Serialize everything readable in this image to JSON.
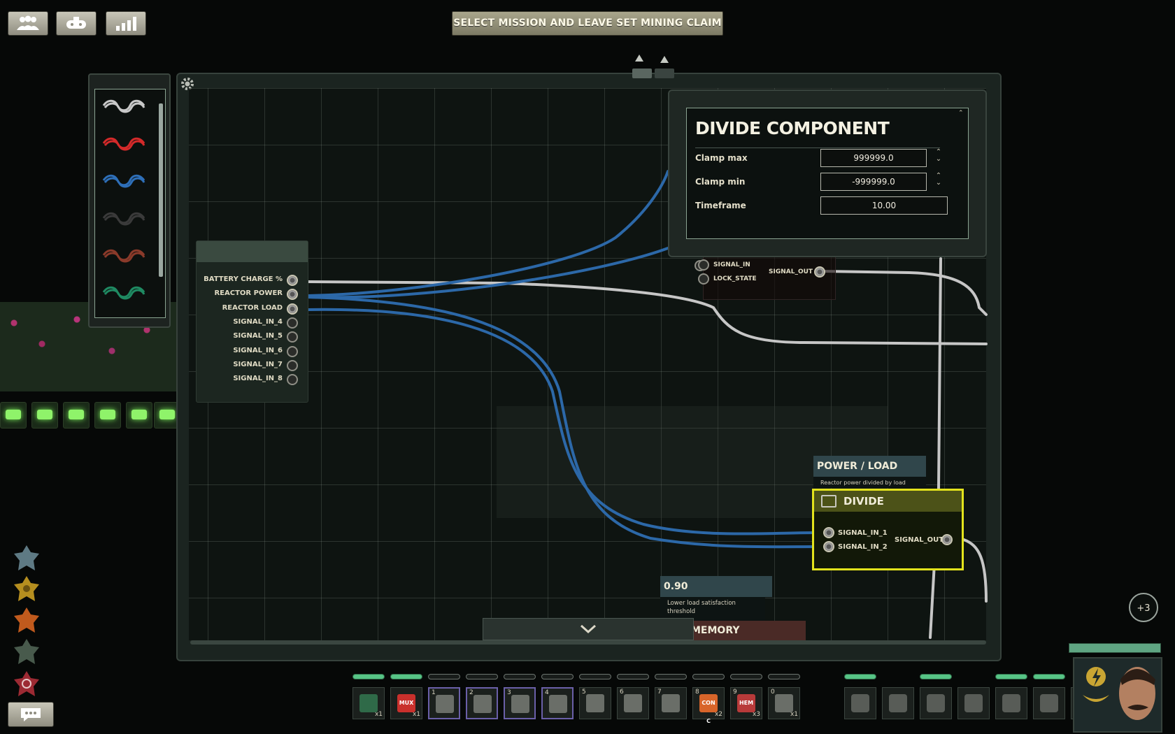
{
  "banner": {
    "text": "SELECT MISSION AND LEAVE SET MINING CLAIM"
  },
  "top_buttons": [
    {
      "icon": "crew-icon"
    },
    {
      "icon": "submarine-icon"
    },
    {
      "icon": "stats-bars-icon"
    }
  ],
  "palette": {
    "wires": [
      "#c8c8c8",
      "#d42a2a",
      "#2e6fb8",
      "#2b2b2b",
      "#8a3a2a",
      "#1f8a62"
    ]
  },
  "input_component": {
    "connectors": [
      {
        "label": "BATTERY CHARGE %",
        "connected": true
      },
      {
        "label": "REACTOR POWER",
        "connected": true
      },
      {
        "label": "REACTOR LOAD",
        "connected": true
      },
      {
        "label": "SIGNAL_IN_4",
        "connected": false
      },
      {
        "label": "SIGNAL_IN_5",
        "connected": false
      },
      {
        "label": "SIGNAL_IN_6",
        "connected": false
      },
      {
        "label": "SIGNAL_IN_7",
        "connected": false
      },
      {
        "label": "SIGNAL_IN_8",
        "connected": false
      }
    ]
  },
  "settings_popup": {
    "title": "DIVIDE COMPONENT",
    "clamp_max_label": "Clamp max",
    "clamp_max_value": "999999.0",
    "clamp_min_label": "Clamp min",
    "clamp_min_value": "-999999.0",
    "timeframe_label": "Timeframe",
    "timeframe_value": "10.00"
  },
  "relay_component": {
    "signal_in": "SIGNAL_IN",
    "lock_state": "LOCK_STATE",
    "signal_out": "SIGNAL_OUT"
  },
  "power_label": {
    "title": "POWER / LOAD",
    "note": "Reactor power divided by load"
  },
  "divide_component": {
    "title": "DIVIDE",
    "in1": "SIGNAL_IN_1",
    "in2": "SIGNAL_IN_2",
    "out": "SIGNAL_OUT"
  },
  "threshold_label": {
    "title": "0.90",
    "note": "Lower load satisfaction threshold"
  },
  "memory_label": {
    "title": "MEMORY"
  },
  "badge": {
    "text": "+3"
  },
  "hotbar": [
    {
      "num": "",
      "qty": "x1",
      "icon": "circuit-board-icon",
      "selected": false,
      "bar": true
    },
    {
      "num": "",
      "qty": "x1",
      "icon": "mux-icon",
      "label": "MUX",
      "selected": false,
      "bar": true
    },
    {
      "num": "1",
      "qty": "",
      "icon": "screwdriver-icon",
      "selected": true,
      "bar": false
    },
    {
      "num": "2",
      "qty": "",
      "icon": "wrench-icon",
      "selected": true,
      "bar": false
    },
    {
      "num": "3",
      "qty": "",
      "icon": "gun-icon",
      "selected": true,
      "bar": false
    },
    {
      "num": "4",
      "qty": "",
      "icon": "screwdriver-icon",
      "selected": true,
      "bar": false
    },
    {
      "num": "5",
      "qty": "",
      "icon": "diving-mask-icon",
      "selected": false,
      "bar": false
    },
    {
      "num": "6",
      "qty": "",
      "icon": "flashlight-icon",
      "selected": false,
      "bar": false
    },
    {
      "num": "7",
      "qty": "",
      "icon": "watering-can-icon",
      "selected": false,
      "bar": false
    },
    {
      "num": "8",
      "qty": "x2",
      "icon": "conc-icon",
      "label": "CON C",
      "selected": false,
      "bar": false
    },
    {
      "num": "9",
      "qty": "x3",
      "icon": "hem-icon",
      "label": "HEM",
      "selected": false,
      "bar": false
    },
    {
      "num": "0",
      "qty": "x1",
      "icon": "syringe-icon",
      "selected": false,
      "bar": false
    }
  ],
  "equipment": [
    {
      "icon": "rifle-icon",
      "bar": true
    },
    {
      "icon": "helmet-icon",
      "bar": false
    },
    {
      "icon": "vest-icon",
      "bar": true
    },
    {
      "icon": "diving-suit-icon",
      "bar": false
    },
    {
      "icon": "goggles-icon",
      "bar": true
    },
    {
      "icon": "headset-icon",
      "bar": true
    },
    {
      "icon": "id-card-icon",
      "bar": false
    }
  ],
  "colors": {
    "wire_blue": "#2c68a8",
    "wire_white": "#c6c6c6",
    "divide_highlight": "#e3e31c",
    "bar_green": "#57c486"
  }
}
